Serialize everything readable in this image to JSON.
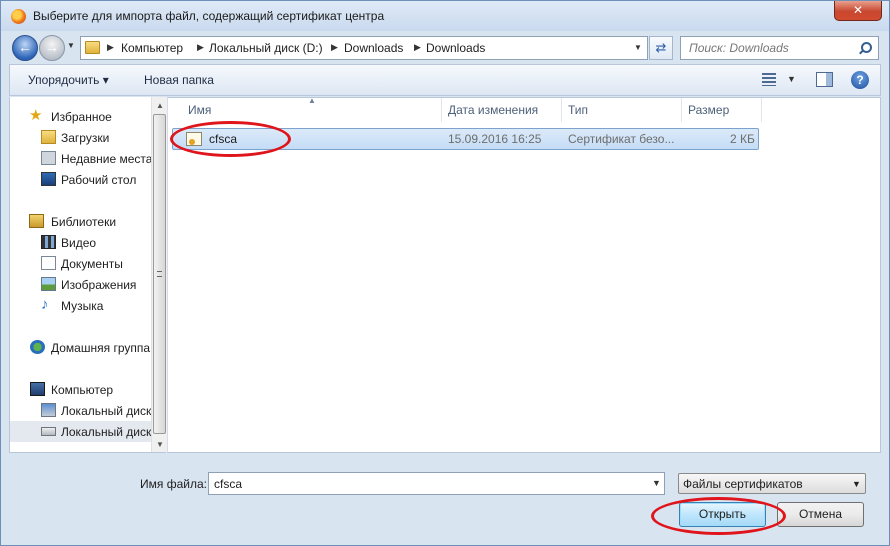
{
  "window": {
    "title": "Выберите для импорта файл, содержащий сертификат центра",
    "close_label": "✕"
  },
  "address": {
    "breadcrumbs": [
      "Компьютер",
      "Локальный диск (D:)",
      "Downloads",
      "Downloads"
    ]
  },
  "search": {
    "placeholder": "Поиск: Downloads"
  },
  "toolbar": {
    "organize": "Упорядочить ▾",
    "new_folder": "Новая папка"
  },
  "nav": {
    "favorites": "Избранное",
    "downloads": "Загрузки",
    "recent": "Недавние места",
    "desktop": "Рабочий стол",
    "libraries": "Библиотеки",
    "video": "Видео",
    "documents": "Документы",
    "images": "Изображения",
    "music": "Музыка",
    "homegroup": "Домашняя группа",
    "computer": "Компьютер",
    "disk_c": "Локальный диск",
    "disk_d": "Локальный диск"
  },
  "columns": {
    "name": "Имя",
    "date": "Дата изменения",
    "type": "Тип",
    "size": "Размер"
  },
  "files": [
    {
      "name": "cfsca",
      "date": "15.09.2016 16:25",
      "type": "Сертификат безо...",
      "size": "2 КБ"
    }
  ],
  "bottom": {
    "filename_label": "Имя файла:",
    "filename_value": "cfsca",
    "filetype_value": "Файлы сертификатов",
    "open_label": "Открыть",
    "cancel_label": "Отмена"
  },
  "colors": {
    "annotation": "#e0141b",
    "selection": "#c4dcf6"
  }
}
